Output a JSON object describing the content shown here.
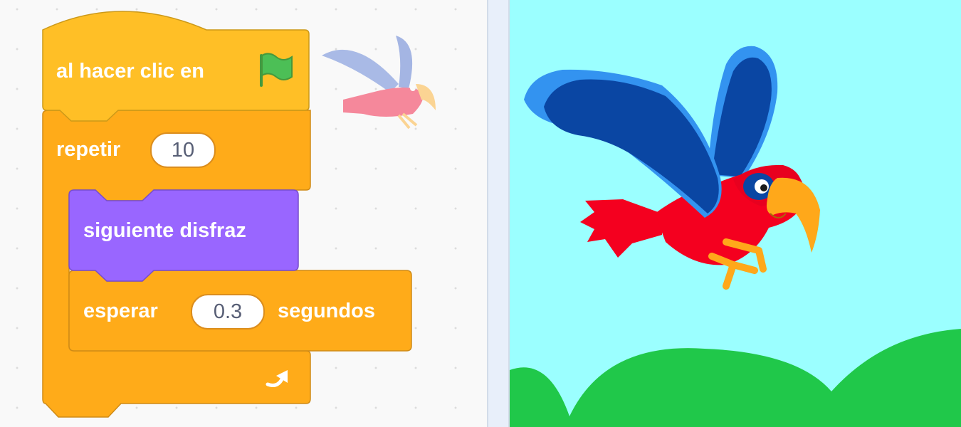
{
  "script": {
    "hat_label": "al hacer clic en",
    "hat_icon": "green-flag-icon",
    "repeat_label": "repetir",
    "repeat_count": "10",
    "costume_label": "siguiente disfraz",
    "wait_label": "esperar",
    "wait_value": "0.3",
    "wait_unit": "segundos",
    "loop_icon": "loop-arrow-icon"
  },
  "colors": {
    "events": "#ffbf26",
    "control": "#ffab19",
    "looks": "#9966ff",
    "stage_sky": "#9bffff",
    "stage_grass": "#20c84a"
  },
  "sprite": {
    "name_icon": "parrot-sprite-icon"
  }
}
